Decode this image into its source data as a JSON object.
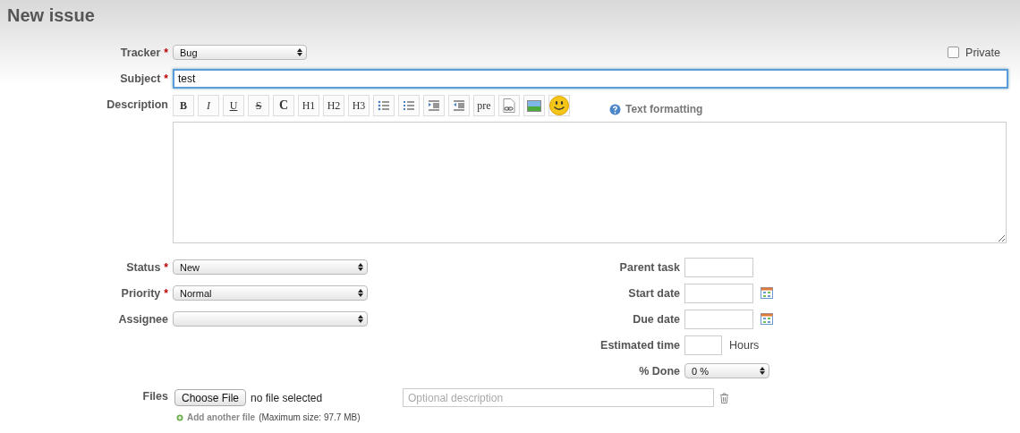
{
  "title": "New issue",
  "required_mark": "*",
  "tracker": {
    "label": "Tracker",
    "required": true,
    "value": "Bug"
  },
  "private": {
    "label": "Private",
    "checked": false
  },
  "subject": {
    "label": "Subject",
    "required": true,
    "value": "test",
    "focused": true
  },
  "description": {
    "label": "Description",
    "help_link": "Text formatting",
    "toolbar": [
      {
        "kind": "bold",
        "label": "B"
      },
      {
        "kind": "italic",
        "label": "I"
      },
      {
        "kind": "underline",
        "label": "U"
      },
      {
        "kind": "strike",
        "label": "S"
      },
      {
        "kind": "code",
        "label": "C"
      },
      {
        "kind": "plain",
        "label": "H1"
      },
      {
        "kind": "plain",
        "label": "H2"
      },
      {
        "kind": "plain",
        "label": "H3"
      },
      {
        "kind": "bullets"
      },
      {
        "kind": "numbers"
      },
      {
        "kind": "indent"
      },
      {
        "kind": "outdent"
      },
      {
        "kind": "plain",
        "label": "pre"
      },
      {
        "kind": "link"
      },
      {
        "kind": "image"
      },
      {
        "kind": "smiley"
      }
    ]
  },
  "left_fields": [
    {
      "label": "Status",
      "required": true,
      "value": "New"
    },
    {
      "label": "Priority",
      "required": true,
      "value": "Normal"
    },
    {
      "label": "Assignee",
      "required": false
    }
  ],
  "right_fields": [
    {
      "kind": "text",
      "label": "Parent task"
    },
    {
      "kind": "date",
      "label": "Start date"
    },
    {
      "kind": "date",
      "label": "Due date"
    },
    {
      "kind": "hours",
      "label": "Estimated time",
      "unit": "Hours"
    },
    {
      "kind": "select",
      "label": "% Done",
      "value": "0 %"
    }
  ],
  "files": {
    "label": "Files",
    "button": "Choose File",
    "status": "no file selected",
    "placeholder": "Optional description",
    "add_link": "Add another file",
    "max_size": "(Maximum size: 97.7 MB)"
  }
}
